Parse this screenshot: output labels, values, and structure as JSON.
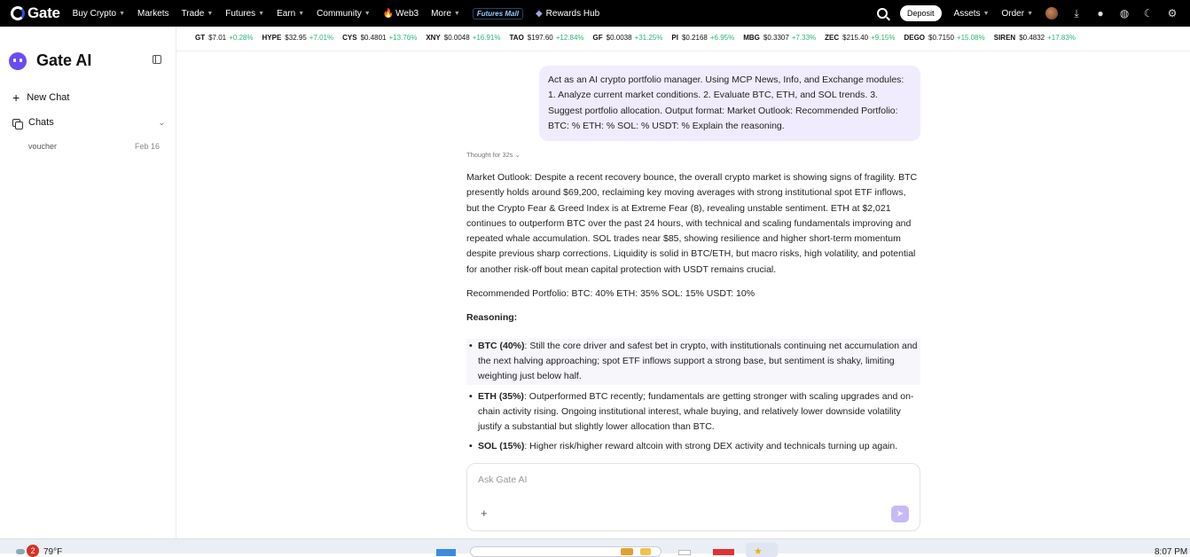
{
  "topnav": {
    "logo": "Gate",
    "items": [
      {
        "label": "Buy Crypto",
        "caret": true
      },
      {
        "label": "Markets",
        "caret": false
      },
      {
        "label": "Trade",
        "caret": true
      },
      {
        "label": "Futures",
        "caret": true
      },
      {
        "label": "Earn",
        "caret": true
      },
      {
        "label": "Community",
        "caret": true
      },
      {
        "label": "Web3",
        "caret": false
      },
      {
        "label": "More",
        "caret": true
      }
    ],
    "futures_mall": "Futures Mall",
    "rewards_hub": "Rewards Hub",
    "deposit": "Deposit",
    "assets": "Assets",
    "order": "Order",
    "icons": [
      "search-icon",
      "download-icon",
      "bell-icon",
      "globe-icon",
      "moon-icon",
      "gear-icon"
    ]
  },
  "sidebar": {
    "title": "Gate AI",
    "new_chat": "New Chat",
    "chats_label": "Chats",
    "chat_items": [
      {
        "title": "voucher",
        "date": "Feb 16"
      }
    ]
  },
  "ticker": [
    {
      "symbol": "GT",
      "price": "$7.01",
      "change": "+0.28%"
    },
    {
      "symbol": "HYPE",
      "price": "$32.95",
      "change": "+7.01%"
    },
    {
      "symbol": "CYS",
      "price": "$0.4801",
      "change": "+13.76%"
    },
    {
      "symbol": "XNY",
      "price": "$0.0048",
      "change": "+16.91%"
    },
    {
      "symbol": "TAO",
      "price": "$197.60",
      "change": "+12.84%"
    },
    {
      "symbol": "GF",
      "price": "$0.0038",
      "change": "+31.25%"
    },
    {
      "symbol": "PI",
      "price": "$0.2168",
      "change": "+6.95%"
    },
    {
      "symbol": "MBG",
      "price": "$0.3307",
      "change": "+7.33%"
    },
    {
      "symbol": "ZEC",
      "price": "$215.40",
      "change": "+9.15%"
    },
    {
      "symbol": "DEGO",
      "price": "$0.7150",
      "change": "+15.08%"
    },
    {
      "symbol": "SIREN",
      "price": "$0.4832",
      "change": "+17.83%"
    }
  ],
  "conversation": {
    "user_message": "Act as an AI crypto portfolio manager. Using MCP News, Info, and Exchange modules: 1. Analyze current market conditions. 2. Evaluate BTC, ETH, and SOL trends. 3. Suggest portfolio allocation. Output format: Market Outlook: Recommended Portfolio: BTC: % ETH: % SOL: % USDT: % Explain the reasoning.",
    "thought": "Thought for 32s",
    "market_outlook": "Market Outlook: Despite a recent recovery bounce, the overall crypto market is showing signs of fragility. BTC presently holds around $69,200, reclaiming key moving averages with strong institutional spot ETF inflows, but the Crypto Fear & Greed Index is at Extreme Fear (8), revealing unstable sentiment. ETH at $2,021 continues to outperform BTC over the past 24 hours, with technical and scaling fundamentals improving and repeated whale accumulation. SOL trades near $85, showing resilience and higher short-term momentum despite previous sharp corrections. Liquidity is solid in BTC/ETH, but macro risks, high volatility, and potential for another risk-off bout mean capital protection with USDT remains crucial.",
    "portfolio": "Recommended Portfolio: BTC: 40% ETH: 35% SOL: 15% USDT: 10%",
    "reasoning_title": "Reasoning:",
    "bullets": [
      {
        "head": "BTC (40%)",
        "text": ": Still the core driver and safest bet in crypto, with institutionals continuing net accumulation and the next halving approaching; spot ETF inflows support a strong base, but sentiment is shaky, limiting weighting just below half."
      },
      {
        "head": "ETH (35%)",
        "text": ": Outperformed BTC recently; fundamentals are getting stronger with scaling upgrades and on-chain activity rising. Ongoing institutional interest, whale buying, and relatively lower downside volatility justify a substantial but slightly lower allocation than BTC."
      },
      {
        "head": "SOL (15%)",
        "text": ": Higher risk/higher reward altcoin with strong DEX activity and technicals turning up again."
      }
    ]
  },
  "input": {
    "placeholder": "Ask Gate AI"
  },
  "taskbar": {
    "badge": "2",
    "temp": "79°F",
    "time": "8:07 PM"
  }
}
